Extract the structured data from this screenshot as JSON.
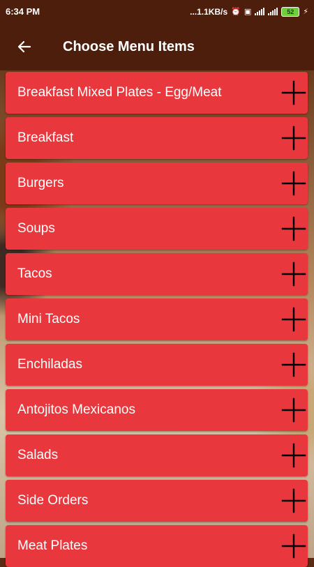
{
  "status_bar": {
    "time": "6:34 PM",
    "network_speed": "...1.1KB/s",
    "battery_level": "52",
    "icons": [
      "alarm-icon",
      "volte-icon",
      "signal-4g-icon",
      "signal-icon",
      "battery-icon",
      "charging-icon"
    ]
  },
  "app_bar": {
    "title": "Choose Menu Items",
    "back_icon": "arrow-left-icon",
    "background_color": "#4e1e0c"
  },
  "menu": {
    "item_color": "#e8383d",
    "item_icon": "plus-icon",
    "items": [
      {
        "label": "Breakfast Mixed Plates - Egg/Meat"
      },
      {
        "label": "Breakfast"
      },
      {
        "label": "Burgers"
      },
      {
        "label": "Soups"
      },
      {
        "label": "Tacos"
      },
      {
        "label": "Mini Tacos"
      },
      {
        "label": "Enchiladas"
      },
      {
        "label": "Antojitos Mexicanos"
      },
      {
        "label": "Salads"
      },
      {
        "label": "Side Orders"
      },
      {
        "label": "Meat Plates"
      }
    ]
  }
}
